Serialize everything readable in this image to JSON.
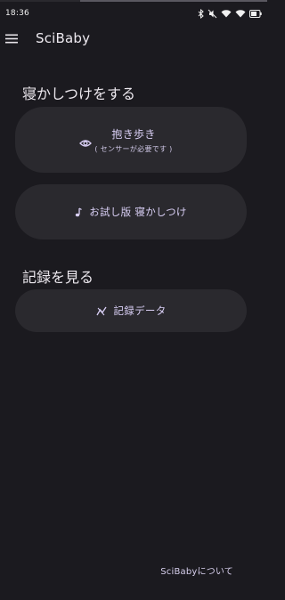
{
  "status_bar": {
    "time": "18:36",
    "icons": [
      "bluetooth-icon",
      "mute-icon",
      "wifi-icon",
      "wifi-icon",
      "battery-icon"
    ]
  },
  "app_bar": {
    "title": "SciBaby",
    "menu_icon": "menu-icon"
  },
  "sections": {
    "sleep": {
      "title": "寝かしつけをする",
      "buttons": {
        "hug_walk": {
          "label": "抱き歩き",
          "sublabel": "( センサーが必要です )",
          "icon": "eye-icon"
        },
        "trial": {
          "label": "お試し版 寝かしつけ",
          "icon": "music-note-icon"
        }
      }
    },
    "records": {
      "title": "記録を見る",
      "buttons": {
        "data": {
          "label": "記録データ",
          "icon": "analytics-icon"
        }
      }
    }
  },
  "footer": {
    "about": "SciBabyについて"
  },
  "colors": {
    "background": "#1b1a1f",
    "pill": "#2a292e",
    "accent_text": "#d9cff5"
  }
}
